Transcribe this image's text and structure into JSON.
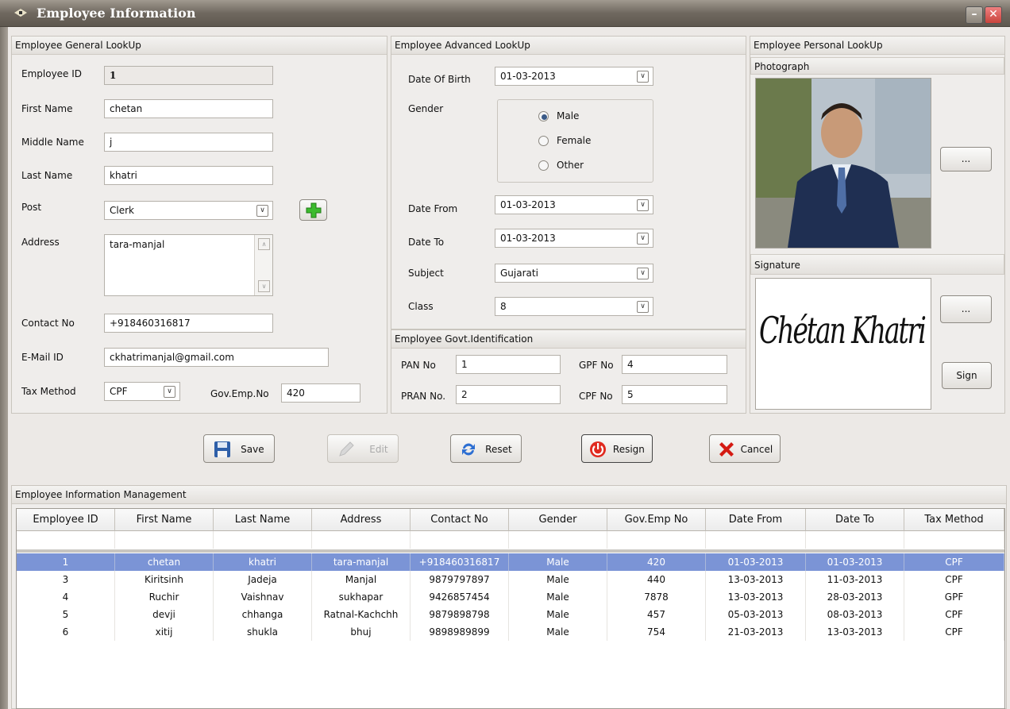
{
  "window": {
    "title": "Employee Information"
  },
  "general": {
    "header": "Employee General LookUp",
    "employee_id_label": "Employee ID",
    "employee_id": "1",
    "first_name_label": "First Name",
    "first_name": "chetan",
    "middle_name_label": "Middle Name",
    "middle_name": "j",
    "last_name_label": "Last Name",
    "last_name": "khatri",
    "post_label": "Post",
    "post": "Clerk",
    "address_label": "Address",
    "address": "tara-manjal",
    "contact_label": "Contact No",
    "contact": "+918460316817",
    "email_label": "E-Mail ID",
    "email": "ckhatrimanjal@gmail.com",
    "tax_label": "Tax Method",
    "tax": "CPF",
    "govemp_label": "Gov.Emp.No",
    "govemp": "420"
  },
  "advanced": {
    "header": "Employee Advanced LookUp",
    "dob_label": "Date Of Birth",
    "dob": "01-03-2013",
    "gender_label": "Gender",
    "gender_options": [
      "Male",
      "Female",
      "Other"
    ],
    "gender_selected": "Male",
    "date_from_label": "Date From",
    "date_from": "01-03-2013",
    "date_to_label": "Date To",
    "date_to": "01-03-2013",
    "subject_label": "Subject",
    "subject": "Gujarati",
    "class_label": "Class",
    "class": "8"
  },
  "govt": {
    "header": "Employee Govt.Identification",
    "pan_label": "PAN No",
    "pan": "1",
    "gpf_label": "GPF No",
    "gpf": "4",
    "pran_label": "PRAN No.",
    "pran": "2",
    "cpf_label": "CPF No",
    "cpf": "5"
  },
  "personal": {
    "header": "Employee Personal LookUp",
    "photo_header": "Photograph",
    "browse_label": "...",
    "signature_header": "Signature",
    "signature_text": "Chétan Khatri",
    "sign_label": "Sign"
  },
  "actions": {
    "save": "Save",
    "edit": "Edit",
    "reset": "Reset",
    "resign": "Resign",
    "cancel": "Cancel"
  },
  "management": {
    "header": "Employee Information Management",
    "columns": [
      "Employee ID",
      "First Name",
      "Last Name",
      "Address",
      "Contact No",
      "Gender",
      "Gov.Emp No",
      "Date From",
      "Date To",
      "Tax Method"
    ],
    "rows": [
      [
        "1",
        "chetan",
        "khatri",
        "tara-manjal",
        "+918460316817",
        "Male",
        "420",
        "01-03-2013",
        "01-03-2013",
        "CPF"
      ],
      [
        "3",
        "Kiritsinh",
        "Jadeja",
        "Manjal",
        "9879797897",
        "Male",
        "440",
        "13-03-2013",
        "11-03-2013",
        "CPF"
      ],
      [
        "4",
        "Ruchir",
        "Vaishnav",
        "sukhapar",
        "9426857454",
        "Male",
        "7878",
        "13-03-2013",
        "28-03-2013",
        "GPF"
      ],
      [
        "5",
        "devji",
        "chhanga",
        "Ratnal-Kachchh",
        "9879898798",
        "Male",
        "457",
        "05-03-2013",
        "08-03-2013",
        "CPF"
      ],
      [
        "6",
        "xitij",
        "shukla",
        "bhuj",
        "9898989899",
        "Male",
        "754",
        "21-03-2013",
        "13-03-2013",
        "CPF"
      ]
    ]
  },
  "colors": {
    "selection": "#7b94d6",
    "titlebar": "#6f685f",
    "panel": "#efedeb"
  }
}
